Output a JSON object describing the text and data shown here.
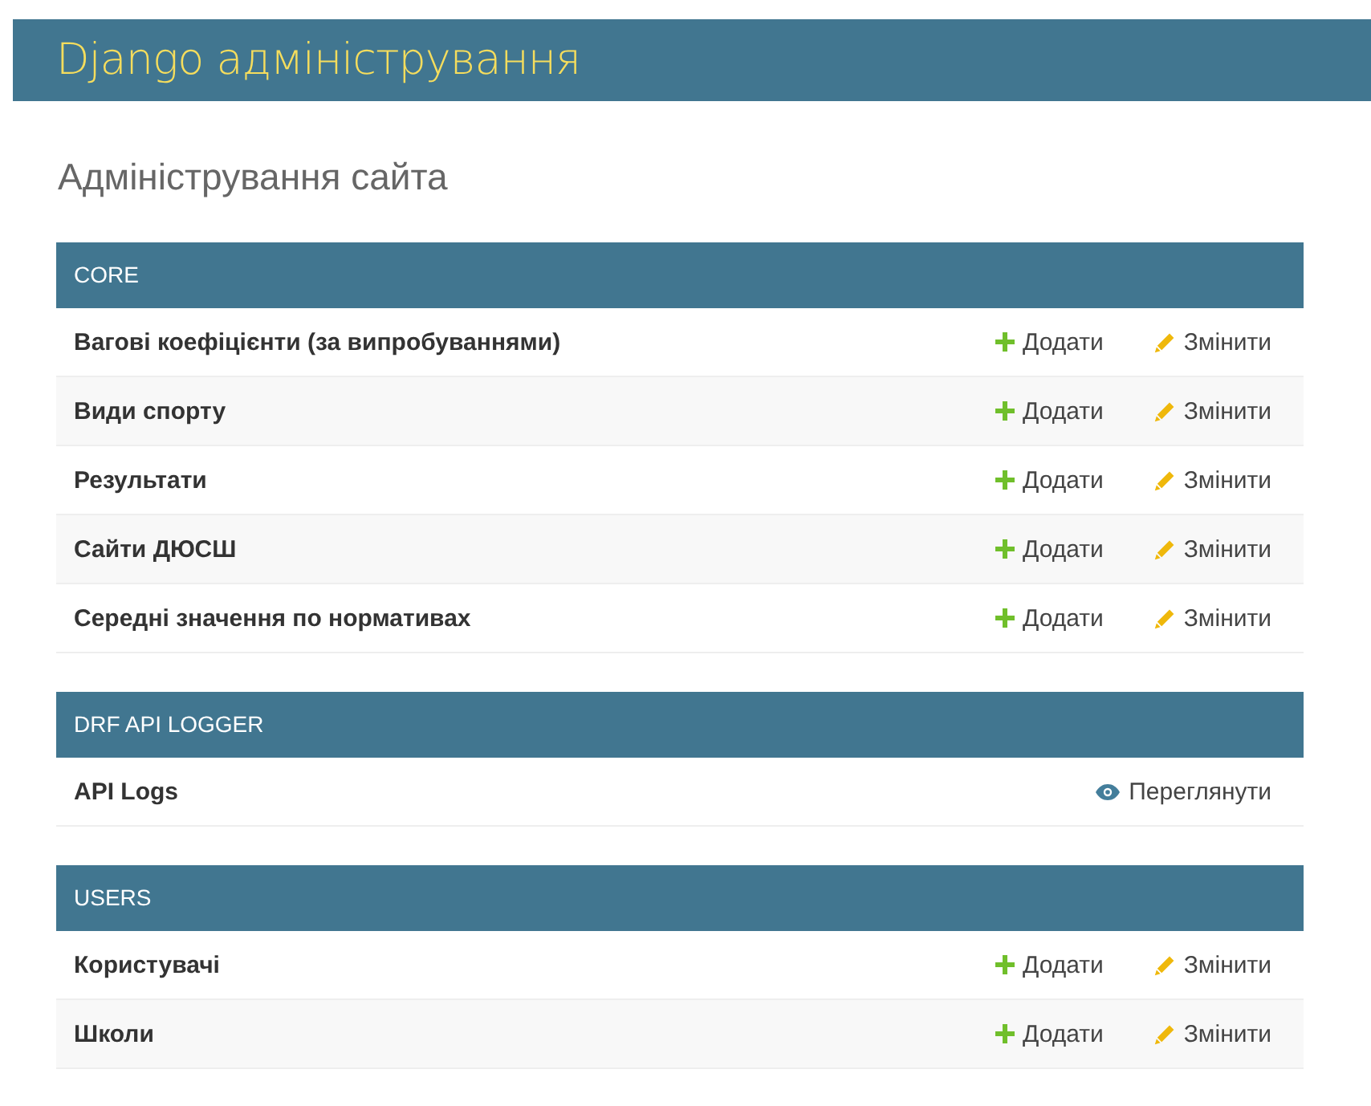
{
  "header": {
    "title": "Django адміністрування"
  },
  "page_title": "Адміністрування сайта",
  "modules": [
    {
      "caption": "CORE",
      "rows": [
        {
          "name": "Вагові коефіцієнти (за випробуваннями)",
          "actions": [
            {
              "kind": "add",
              "label": "Додати"
            },
            {
              "kind": "change",
              "label": "Змінити"
            }
          ]
        },
        {
          "name": "Види спорту",
          "actions": [
            {
              "kind": "add",
              "label": "Додати"
            },
            {
              "kind": "change",
              "label": "Змінити"
            }
          ]
        },
        {
          "name": "Результати",
          "actions": [
            {
              "kind": "add",
              "label": "Додати"
            },
            {
              "kind": "change",
              "label": "Змінити"
            }
          ]
        },
        {
          "name": "Сайти ДЮСШ",
          "actions": [
            {
              "kind": "add",
              "label": "Додати"
            },
            {
              "kind": "change",
              "label": "Змінити"
            }
          ]
        },
        {
          "name": "Середні значення по нормативах",
          "actions": [
            {
              "kind": "add",
              "label": "Додати"
            },
            {
              "kind": "change",
              "label": "Змінити"
            }
          ]
        }
      ]
    },
    {
      "caption": "DRF API LOGGER",
      "rows": [
        {
          "name": "API Logs",
          "actions": [
            {
              "kind": "view",
              "label": "Переглянути"
            }
          ]
        }
      ]
    },
    {
      "caption": "USERS",
      "rows": [
        {
          "name": "Користувачі",
          "actions": [
            {
              "kind": "add",
              "label": "Додати"
            },
            {
              "kind": "change",
              "label": "Змінити"
            }
          ]
        },
        {
          "name": "Школи",
          "actions": [
            {
              "kind": "add",
              "label": "Додати"
            },
            {
              "kind": "change",
              "label": "Змінити"
            }
          ]
        }
      ]
    }
  ]
}
